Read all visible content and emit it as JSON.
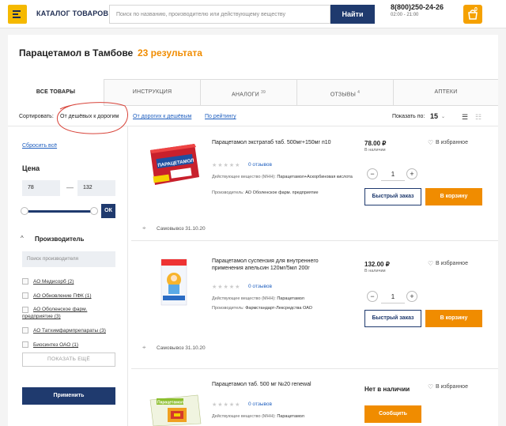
{
  "header": {
    "catalog_label": "КАТАЛОГ ТОВАРОВ",
    "search_placeholder": "Поиск по названию, производителю или действующему веществу",
    "search_button": "Найти",
    "phone": "8(800)250-24-26",
    "hours": "02:00 - 21:00",
    "cart_count": "0"
  },
  "page": {
    "title": "Парацетамол в Тамбове",
    "count": "23 результата"
  },
  "tabs": [
    {
      "label": "ВСЕ ТОВАРЫ",
      "badge": ""
    },
    {
      "label": "ИНСТРУКЦИЯ",
      "badge": ""
    },
    {
      "label": "АНАЛОГИ",
      "badge": "39"
    },
    {
      "label": "ОТЗЫВЫ",
      "badge": "4"
    },
    {
      "label": "АПТЕКИ",
      "badge": ""
    }
  ],
  "sort": {
    "label": "Сортировать:",
    "options": [
      "От дешёвых к дорогим",
      "От дорогих к дешёвым",
      "По рейтингу"
    ],
    "show_label": "Показать по:",
    "show_value": "15"
  },
  "filters": {
    "reset": "Сбросить всё",
    "price_label": "Цена",
    "price_min": "78",
    "price_max": "132",
    "ok": "ОК",
    "manufacturer_label": "Производитель",
    "manufacturer_search": "Поиск производителя",
    "manufacturers": [
      "АО Медисорб (2)",
      "АО Обновление ПФК (1)",
      "АО Оболенское фарм.",
      "предприятие (3)",
      "АО Татхимфармпрепараты (3)",
      "Биосинтез ОАО (1)"
    ],
    "show_more": "ПОКАЗАТЬ ЕЩЁ",
    "apply": "Применить"
  },
  "products": [
    {
      "name": "Парацетамол экстратаб таб. 500мг+150мг п10",
      "reviews": "0 отзывов",
      "substance_label": "Действующее вещество (МНН):",
      "substance": "Парацетамол+Аскорбиновая кислота",
      "maker_label": "Производитель:",
      "maker": "АО Оболенское фарм. предприятие",
      "price": "78.00 ₽",
      "stock": "В наличии",
      "fav": "В избранное",
      "qty": "1",
      "fast": "Быстрый заказ",
      "cart": "В корзину",
      "pickup": "Самовывоз 31.10.20",
      "box_text": "ПАРАЦЕТАМОЛ"
    },
    {
      "name": "Парацетамол суспензия для внутреннего применения апельсин 120мг/5мл 200г",
      "reviews": "0 отзывов",
      "substance_label": "Действующее вещество (МНН):",
      "substance": "Парацетамол",
      "maker_label": "Производитель:",
      "maker": "Фармстандарт-Лексредства ОАО",
      "price": "132.00 ₽",
      "stock": "В наличии",
      "fav": "В избранное",
      "qty": "1",
      "fast": "Быстрый заказ",
      "cart": "В корзину",
      "pickup": "Самовывоз 31.10.20"
    },
    {
      "name": "Парацетамол таб. 500 мг №20 renewal",
      "reviews": "0 отзывов",
      "substance_label": "Действующее вещество (МНН):",
      "substance": "Парацетамол",
      "not_available": "Нет в наличии",
      "fav": "В избранное",
      "notify": "Сообщить",
      "box_text": "Парацетамол"
    }
  ],
  "colors": {
    "accent": "#f08c00",
    "navy": "#1f3a6e",
    "link": "#1f5fbf"
  }
}
